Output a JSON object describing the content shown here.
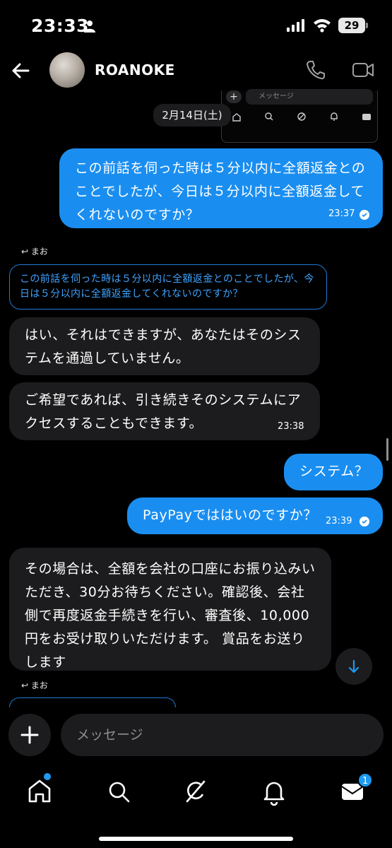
{
  "status_bar": {
    "time": "23:33",
    "battery": "29"
  },
  "header": {
    "contact_name": "ROANOKE"
  },
  "embedded": {
    "placeholder": "メッセージ"
  },
  "date_chip": "2月14日(土)",
  "messages": [
    {
      "direction": "out",
      "text": "この前話を伺った時は５分以内に全額返金とのことでしたが、今日は５分以内に全額返金してくれないのですか？",
      "time": "23:37"
    },
    {
      "direction": "in",
      "reply_to": "まお",
      "quote": "この前話を伺った時は５分以内に全額返金とのことでしたが、今日は５分以内に全額返金してくれないのですか？",
      "text": "はい、それはできますが、あなたはそのシステムを通過していません。"
    },
    {
      "direction": "in",
      "text": "ご希望であれば、引き続きそのシステムにアクセスすることもできます。",
      "time": "23:38"
    },
    {
      "direction": "out",
      "text": "システム？"
    },
    {
      "direction": "out",
      "text": "PayPayでははいのですか？",
      "time": "23:39"
    },
    {
      "direction": "in",
      "text": "その場合は、全額を会社の口座にお振り込みいただき、30分お待ちください。確認後、会社側で再度返金手続きを行い、審査後、10,000円をお受け取りいただけます。 賞品をお送りします"
    },
    {
      "direction": "in",
      "reply_to": "まお"
    }
  ],
  "composer": {
    "placeholder": "メッセージ"
  },
  "tabbar": {
    "items": [
      "home-icon",
      "search-icon",
      "grok-icon",
      "notifications-icon",
      "messages-icon"
    ],
    "messages_badge": "1"
  },
  "colors": {
    "accent": "#1a8ef0",
    "incoming_bubble": "#1c1c1e",
    "background": "#000000"
  }
}
